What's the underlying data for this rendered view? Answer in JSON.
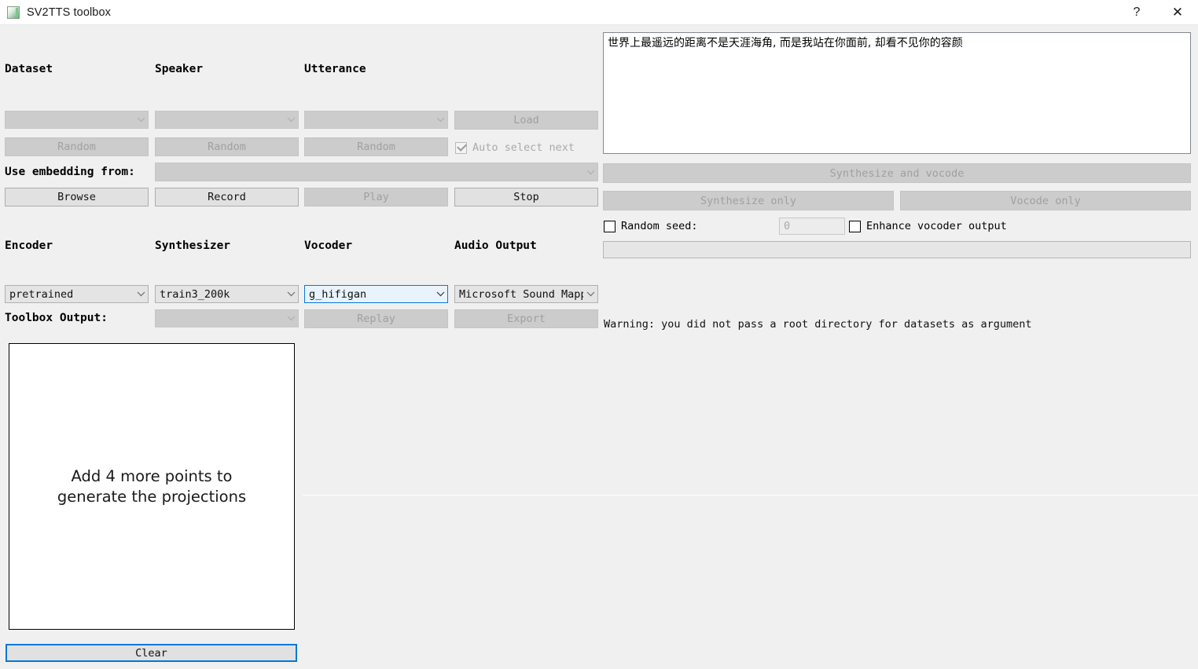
{
  "window": {
    "title": "SV2TTS toolbox",
    "icon": "app-icon",
    "help_label": "?",
    "close_label": "✕"
  },
  "selection": {
    "headers": {
      "dataset": "Dataset",
      "speaker": "Speaker",
      "utterance": "Utterance"
    },
    "dataset_combo": {
      "value": "",
      "disabled": true
    },
    "speaker_combo": {
      "value": "",
      "disabled": true
    },
    "utterance_combo": {
      "value": "",
      "disabled": true
    },
    "load_button": {
      "label": "Load",
      "disabled": true
    },
    "random_dataset": {
      "label": "Random",
      "disabled": true
    },
    "random_speaker": {
      "label": "Random",
      "disabled": true
    },
    "random_utterance": {
      "label": "Random",
      "disabled": true
    },
    "auto_select_next": {
      "label": "Auto select next",
      "checked": true,
      "disabled": true
    },
    "use_embedding_label": "Use embedding from:",
    "use_embedding_combo": {
      "value": "",
      "disabled": true
    },
    "browse_button": {
      "label": "Browse",
      "disabled": false
    },
    "record_button": {
      "label": "Record",
      "disabled": false
    },
    "play_button": {
      "label": "Play",
      "disabled": true
    },
    "stop_button": {
      "label": "Stop",
      "disabled": false
    }
  },
  "models": {
    "headers": {
      "encoder": "Encoder",
      "synthesizer": "Synthesizer",
      "vocoder": "Vocoder",
      "audio_output": "Audio Output"
    },
    "encoder_combo": {
      "value": "pretrained",
      "disabled": false
    },
    "synthesizer_combo": {
      "value": "train3_200k",
      "disabled": false
    },
    "vocoder_combo": {
      "value": "g_hifigan",
      "disabled": false,
      "focused": true
    },
    "audio_output_combo": {
      "value": "Microsoft Sound Mapp",
      "disabled": false
    },
    "toolbox_output_label": "Toolbox Output:",
    "toolbox_output_combo": {
      "value": "",
      "disabled": true
    },
    "replay_button": {
      "label": "Replay",
      "disabled": true
    },
    "export_button": {
      "label": "Export",
      "disabled": true
    }
  },
  "generation": {
    "text_input": "世界上最遥远的距离不是天涯海角, 而是我站在你面前, 却看不见你的容颜",
    "synthesize_and_vocode": {
      "label": "Synthesize and vocode",
      "disabled": true
    },
    "synthesize_only": {
      "label": "Synthesize only",
      "disabled": true
    },
    "vocode_only": {
      "label": "Vocode only",
      "disabled": true
    },
    "random_seed": {
      "label": "Random seed:",
      "checked": false,
      "disabled": false
    },
    "seed_value": "0",
    "enhance_vocoder_output": {
      "label": "Enhance vocoder output",
      "checked": false,
      "disabled": false
    },
    "warning_text": "Warning: you did not pass a root directory for datasets as argument"
  },
  "umap": {
    "message_line1": "Add 4 more points to",
    "message_line2": "generate the projections",
    "clear_button": {
      "label": "Clear",
      "focused": true
    }
  },
  "colors": {
    "window_bg": "#f0f0f0",
    "titlebar_bg": "#ffffff",
    "button_enabled": "#e1e1e1",
    "button_disabled": "#cccccc",
    "focus_blue": "#0078d7",
    "focused_combo_bg": "#e8f3fd",
    "text": "#000000",
    "disabled_text": "#a0a0a0"
  }
}
